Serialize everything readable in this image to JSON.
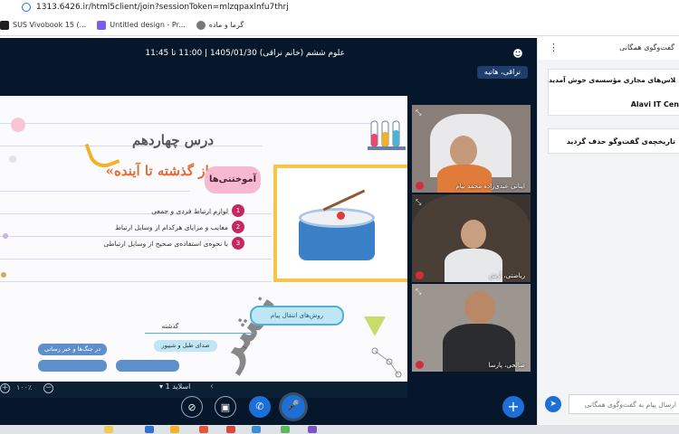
{
  "browser": {
    "url": "1313.6426.ir/html5client/join?sessionToken=mlzqpaxlnfu7thrj",
    "bookmarks": [
      {
        "label": "SUS Vivobook 15 (...",
        "color": "#1f1f1f"
      },
      {
        "label": "Untitled design - Pr...",
        "color": "#7b5cf2"
      },
      {
        "label": "گرما و ماده",
        "color": "#555555"
      }
    ]
  },
  "meeting": {
    "class_title": "علوم ششم (خانم نراقی) 1405/01/30 | 11:00 تا 11:45",
    "presenter_badge": "نراقی، هانیه"
  },
  "slide": {
    "lesson_number": "درس چهاردهم",
    "lesson_title": "«از گذشته تا آینده»",
    "learnings_badge": "آموختنی‌ها",
    "learnings": [
      {
        "num": "1",
        "text": "لوازم ارتباط فردی و جمعی"
      },
      {
        "num": "2",
        "text": "معایب و مزایای هرکدام از وسایل ارتباط"
      },
      {
        "num": "3",
        "text": "با نحوه‌ی استفاده‌ی صحیح از وسایل ارتباطی"
      }
    ],
    "mindmap_root": "روش‌های انتقال پیام",
    "mindmap_past": "گذشته",
    "mindmap_items": [
      "صدای طبل و شیپور",
      "در جنگ‌ها و خبر رسانی"
    ],
    "watermark": "نشر"
  },
  "slide_toolbar": {
    "zoom_level": "۱۰۰٪",
    "slide_selector": "اسلاید 1",
    "zoom_in": "+",
    "zoom_out": "−"
  },
  "webcams": [
    {
      "name": "اینانی عبدی‌زاده محمد بیام",
      "bg": "#8a7f78"
    },
    {
      "name": "ریاضتی، آرش",
      "bg": "#3a3430"
    },
    {
      "name": "صالحی، پارسا",
      "bg": "#9c9590"
    }
  ],
  "chat": {
    "title": "گفت‌وگوی همگانی",
    "welcome": "به کلاس‌های مجازی مؤسسه‌ی خوش آمدید",
    "brand": "Alavi IT Cen",
    "cleared": "تاریخچه‌ی گفت‌وگو حذف گردید",
    "input_placeholder": "ارسال پیام به گفت‌وگوی همگانی"
  },
  "colors": {
    "accent": "#1b6fd6",
    "background": "#06172b",
    "lesson_title": "#e36c35"
  }
}
